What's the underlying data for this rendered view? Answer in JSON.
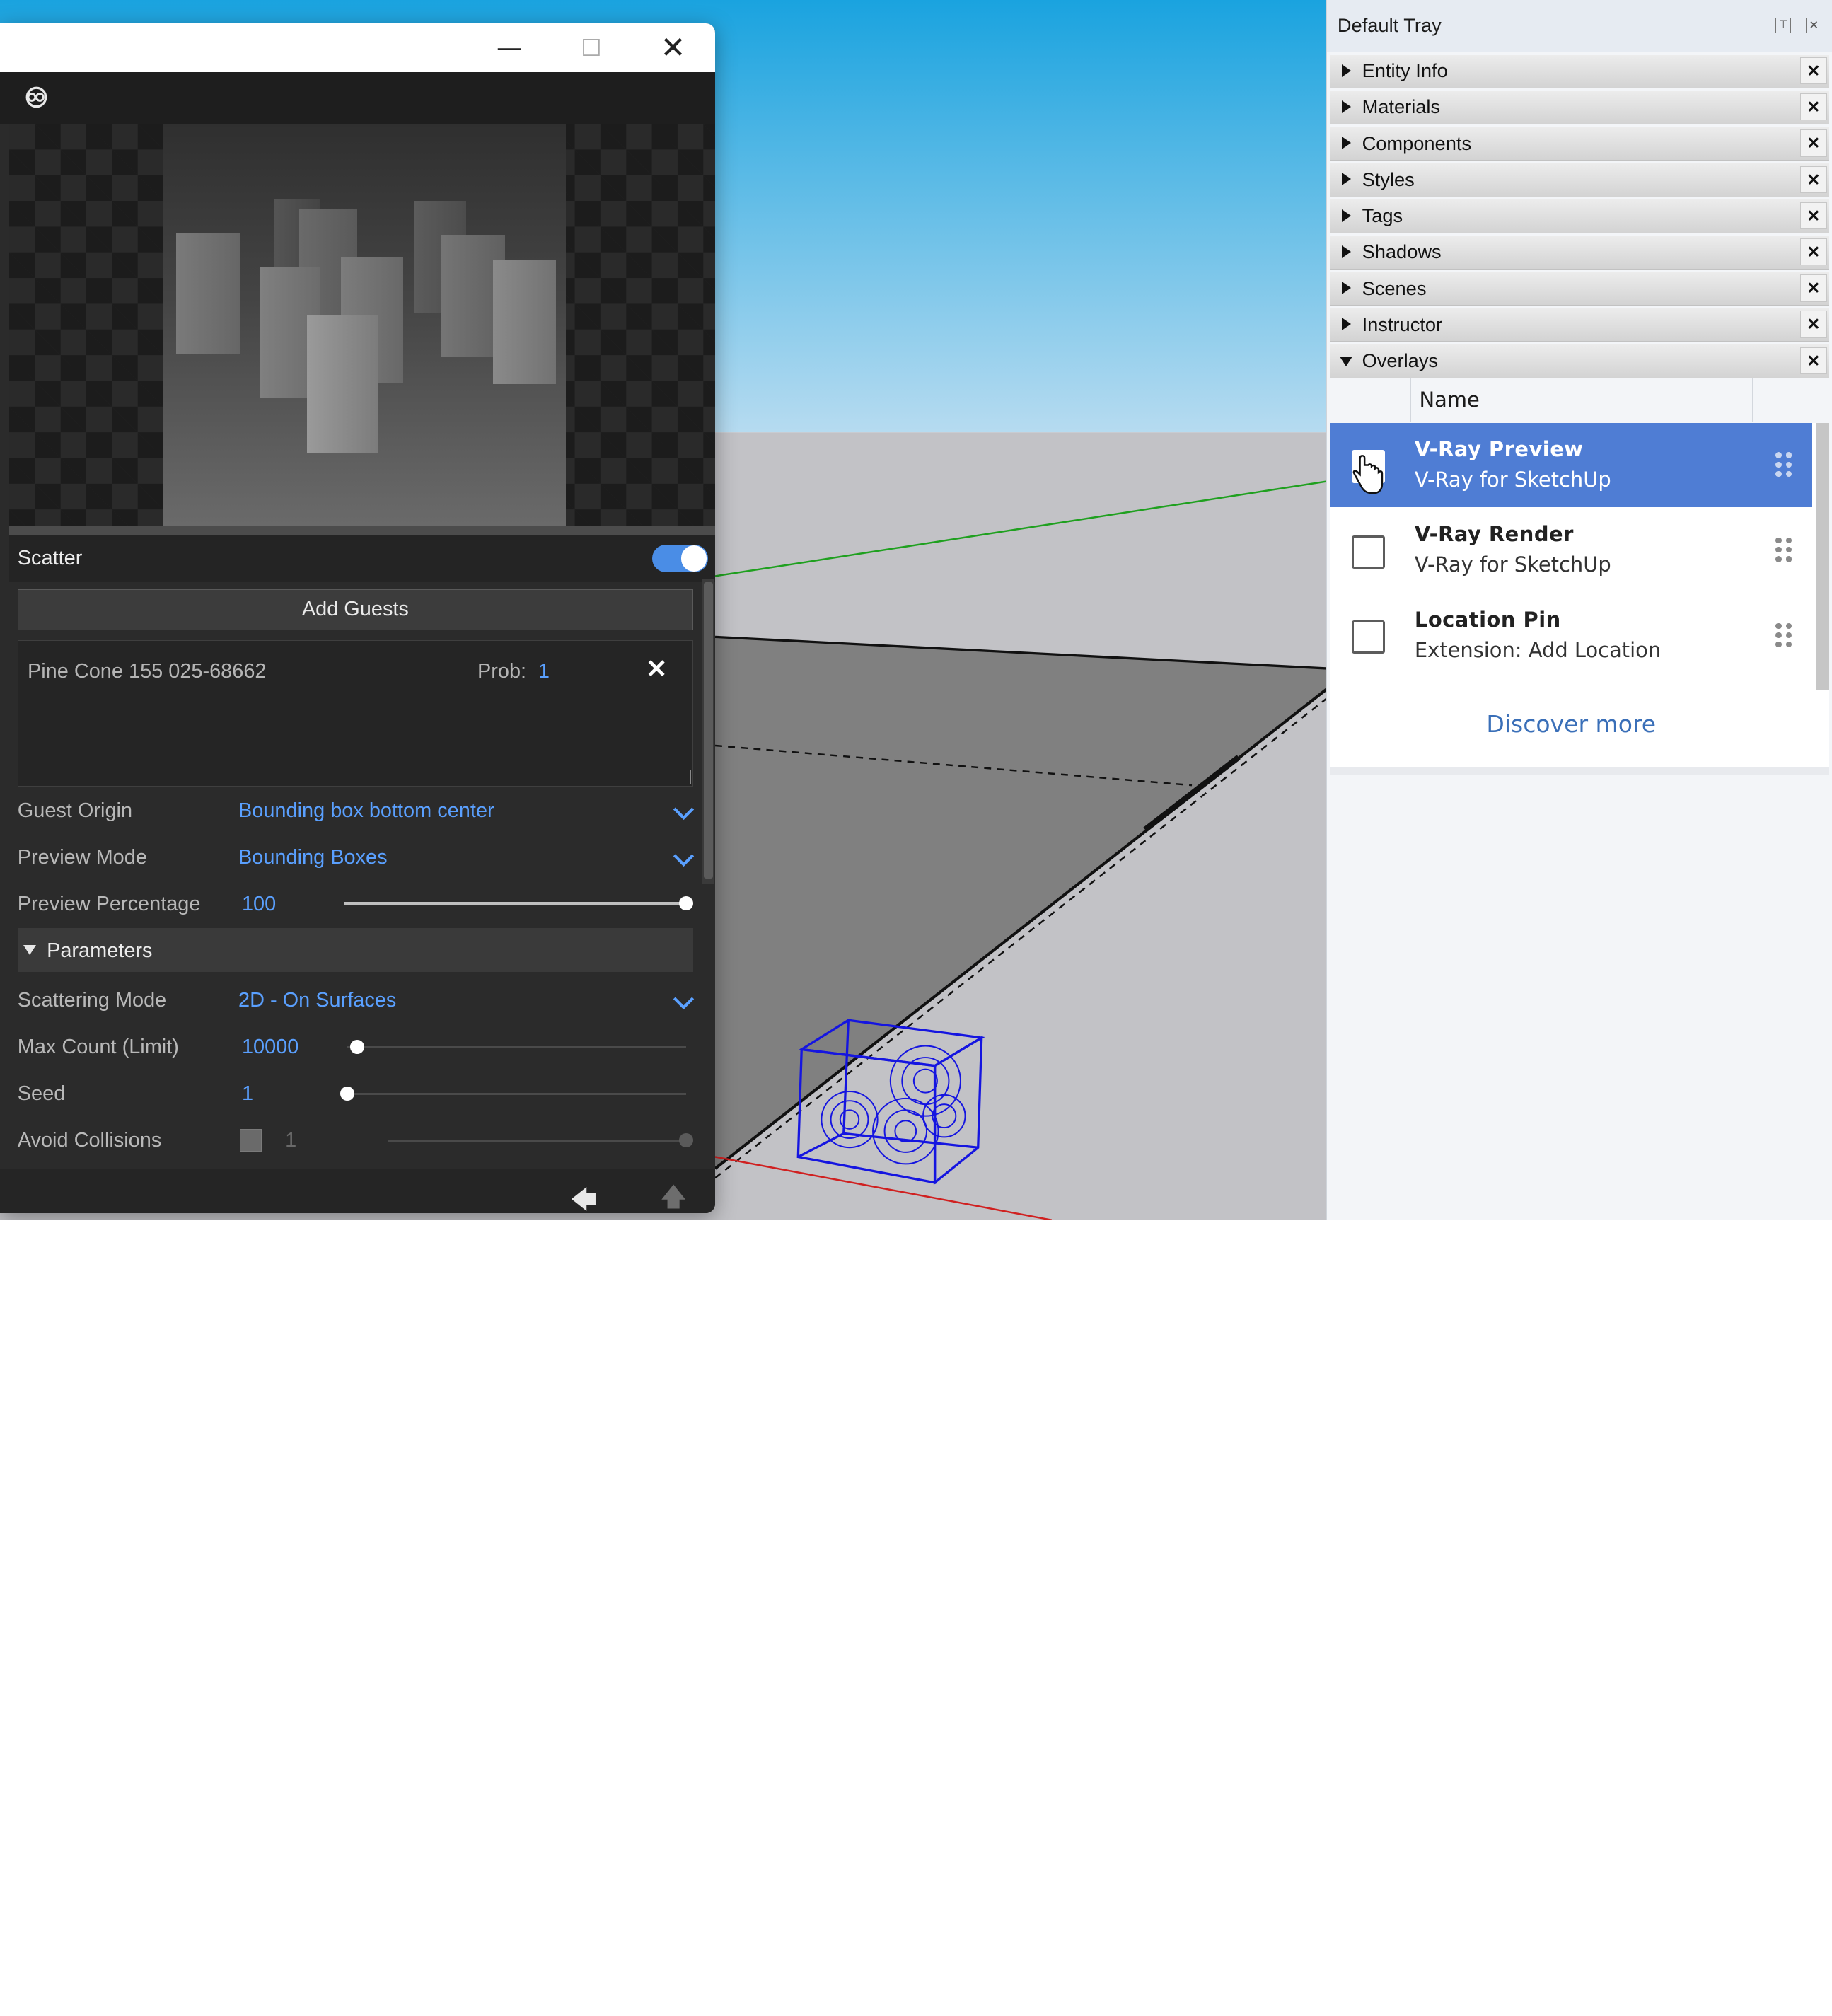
{
  "scatter_window": {
    "window_controls": {
      "minimize": "—",
      "maximize": "☐",
      "close": "✕"
    },
    "scatter": {
      "title": "Scatter",
      "enabled": true
    },
    "add_guests_label": "Add Guests",
    "guests": [
      {
        "name": "Pine Cone 155 025-68662",
        "prob_label": "Prob:",
        "prob_value": "1",
        "remove": "✕"
      }
    ],
    "guest_origin": {
      "label": "Guest Origin",
      "value": "Bounding box bottom center"
    },
    "preview_mode": {
      "label": "Preview Mode",
      "value": "Bounding Boxes"
    },
    "preview_percentage": {
      "label": "Preview Percentage",
      "value": "100",
      "fraction": 1.0
    },
    "parameters": {
      "title": "Parameters",
      "scattering_mode": {
        "label": "Scattering Mode",
        "value": "2D - On Surfaces"
      },
      "max_count": {
        "label": "Max Count (Limit)",
        "value": "10000",
        "fraction": 0.03
      },
      "seed": {
        "label": "Seed",
        "value": "1",
        "fraction": 0.0
      },
      "avoid_collisions": {
        "label": "Avoid Collisions",
        "checked": false,
        "value": "1",
        "fraction": 1.0
      }
    },
    "footer": {
      "back": "🡄",
      "up": "🡅"
    }
  },
  "tray": {
    "title": "Default Tray",
    "pin_icon": "pin-icon",
    "close_icon": "close-icon",
    "panels": [
      {
        "label": "Entity Info",
        "expanded": false
      },
      {
        "label": "Materials",
        "expanded": false
      },
      {
        "label": "Components",
        "expanded": false
      },
      {
        "label": "Styles",
        "expanded": false
      },
      {
        "label": "Tags",
        "expanded": false
      },
      {
        "label": "Shadows",
        "expanded": false
      },
      {
        "label": "Scenes",
        "expanded": false
      },
      {
        "label": "Instructor",
        "expanded": false
      },
      {
        "label": "Overlays",
        "expanded": true
      }
    ],
    "panel_close": "✕",
    "overlays": {
      "column_name": "Name",
      "items": [
        {
          "title": "V-Ray Preview",
          "source": "V-Ray for SketchUp",
          "checked": false,
          "selected": true
        },
        {
          "title": "V-Ray Render",
          "source": "V-Ray for SketchUp",
          "checked": false,
          "selected": false
        },
        {
          "title": "Location Pin",
          "source": "Extension: Add Location",
          "checked": false,
          "selected": false
        }
      ],
      "discover_more": "Discover more"
    }
  },
  "colors": {
    "sky_top": "#1aa3df",
    "sky_bottom": "#b6dbf0",
    "ground": "#c2c2c6",
    "accent_blue": "#5aa0ff",
    "selection_blue": "#4f7dd4",
    "scatter_bbox": "#1515e0",
    "green_axis": "#1fa01f",
    "red_axis": "#d02020"
  }
}
